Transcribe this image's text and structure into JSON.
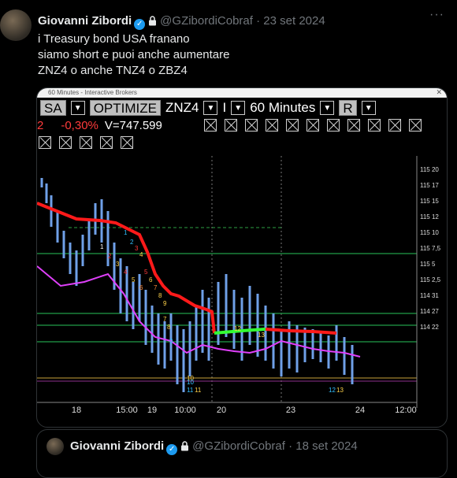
{
  "tweet": {
    "author_name": "Giovanni Zibordi",
    "handle": "@GZibordiCobraf",
    "date": "23 set 2024",
    "lines": [
      "i Treasury bond USA franano",
      "siamo short e puoi anche aumentare",
      "ZNZ4 o anche TNZ4 o ZBZ4"
    ]
  },
  "chart_window": {
    "title": "60 Minutes - Interactive Brokers",
    "sa_label": "SA",
    "optimize_label": "OPTIMIZE",
    "symbol": "ZNZ4",
    "type_value": "I",
    "interval": "60 Minutes",
    "r_value": "R",
    "position": "2",
    "change": "-0,30%",
    "volume": "V=747.599"
  },
  "chart_data": {
    "type": "line",
    "x_ticks": [
      "18",
      "15:00",
      "19",
      "10:00",
      "20",
      "23",
      "24",
      "12:00"
    ],
    "y_ticks": [
      "115 20",
      "115 17",
      "115 15",
      "115 12",
      "115 10",
      "115 7,5",
      "115 5",
      "115 2,5",
      "114 31",
      "114 27",
      "114 22"
    ],
    "markers": [
      "1",
      "2",
      "3",
      "4",
      "5",
      "6",
      "7",
      "8",
      "9",
      "10",
      "11",
      "12",
      "13",
      "1",
      "2",
      "3",
      "4",
      "5",
      "6",
      "7",
      "8",
      "9",
      "10",
      "11",
      "12",
      "13"
    ],
    "colors": {
      "background": "#000000",
      "price": "#6fa0e8",
      "ema": "#e040fb",
      "trend_down": "#ff1a1a",
      "trend_up": "#33ff33"
    }
  },
  "quote": {
    "author_name": "Giovanni Zibordi",
    "handle": "@GZibordiCobraf",
    "date": "18 set 2024"
  }
}
